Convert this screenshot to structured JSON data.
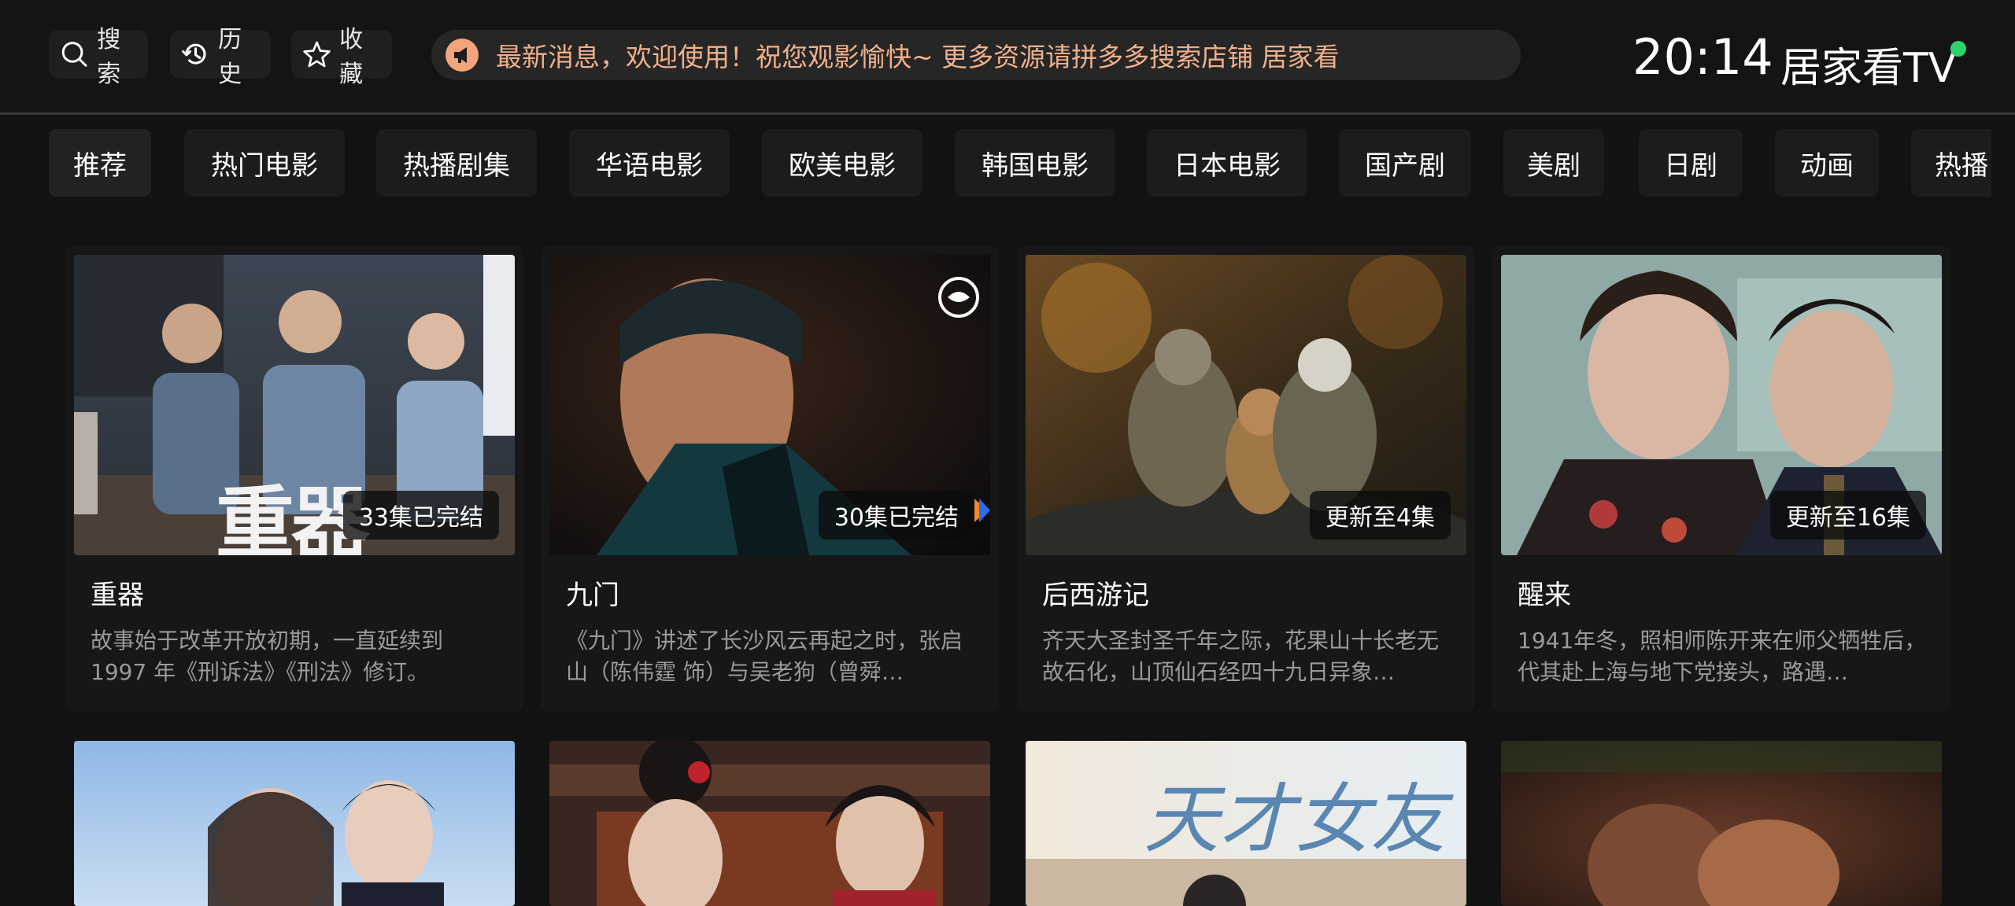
{
  "header": {
    "search_label": "搜索",
    "history_label": "历史",
    "favorite_label": "收藏",
    "ticker_text": "最新消息，欢迎使用！祝您观影愉快~ 更多资源请拼多多搜索店铺 居家看",
    "clock": "20:14",
    "brand": "居家看TV",
    "status_color": "#2bd46c"
  },
  "tabs": [
    {
      "label": "推荐"
    },
    {
      "label": "热门电影"
    },
    {
      "label": "热播剧集"
    },
    {
      "label": "华语电影"
    },
    {
      "label": "欧美电影"
    },
    {
      "label": "韩国电影"
    },
    {
      "label": "日本电影"
    },
    {
      "label": "国产剧"
    },
    {
      "label": "美剧"
    },
    {
      "label": "日剧"
    },
    {
      "label": "动画"
    },
    {
      "label": "热播"
    }
  ],
  "cards": [
    {
      "title": "重器",
      "badge": "33集已完结",
      "description": "故事始于改革开放初期，一直延续到 1997 年《刑诉法》《刑法》修订。",
      "poster_text": "重器"
    },
    {
      "title": "九门",
      "badge": "30集已完结",
      "description": "《九门》讲述了长沙风云再起之时，张启山（陈伟霆 饰）与吴老狗（曾舜…"
    },
    {
      "title": "后西游记",
      "badge": "更新至4集",
      "description": "齐天大圣封圣千年之际，花果山十长老无故石化，山顶仙石经四十九日异象…"
    },
    {
      "title": "醒来",
      "badge": "更新至16集",
      "description": "1941年冬，照相师陈开来在师父牺牲后，代其赴上海与地下党接头，路遇…"
    }
  ],
  "row2_posters": [
    {
      "poster_text": ""
    },
    {
      "poster_text": ""
    },
    {
      "poster_text": "天才女友"
    },
    {
      "poster_text": ""
    }
  ],
  "colors": {
    "background": "#121212",
    "ticker_text": "#f0b08a",
    "accent_dot": "#2bd46c"
  }
}
